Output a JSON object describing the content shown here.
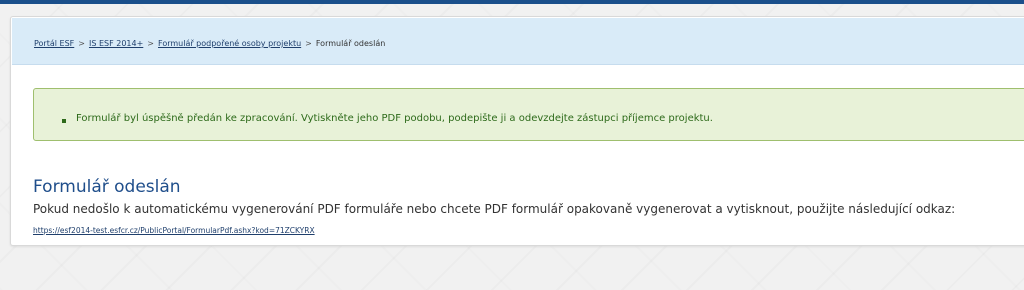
{
  "breadcrumb": {
    "items": [
      "Portál ESF",
      "IS ESF 2014+",
      "Formulář podpořené osoby projektu"
    ],
    "current": "Formulář odeslán",
    "separator": ">"
  },
  "alert": {
    "message": "Formulář byl úspěšně předán ke zpracování. Vytiskněte jeho PDF podobu, podepište ji a odevzdejte zástupci příjemce projektu."
  },
  "main": {
    "title": "Formulář odeslán",
    "info": "Pokud nedošlo k automatickému vygenerování PDF formuláře nebo chcete PDF formulář opakovaně vygenerovat a vytisknout, použijte následující odkaz:",
    "link": "https://esf2014-test.esfcr.cz/PublicPortal/FormularPdf.ashx?kod=71ZCKYRX"
  },
  "colors": {
    "header_stripe": "#1a4f8b",
    "breadcrumb_bg": "#d9ebf8",
    "alert_bg": "#e8f2d8",
    "alert_border": "#9fbf6e",
    "alert_text": "#2d6a1a",
    "title": "#1f4e8b"
  }
}
